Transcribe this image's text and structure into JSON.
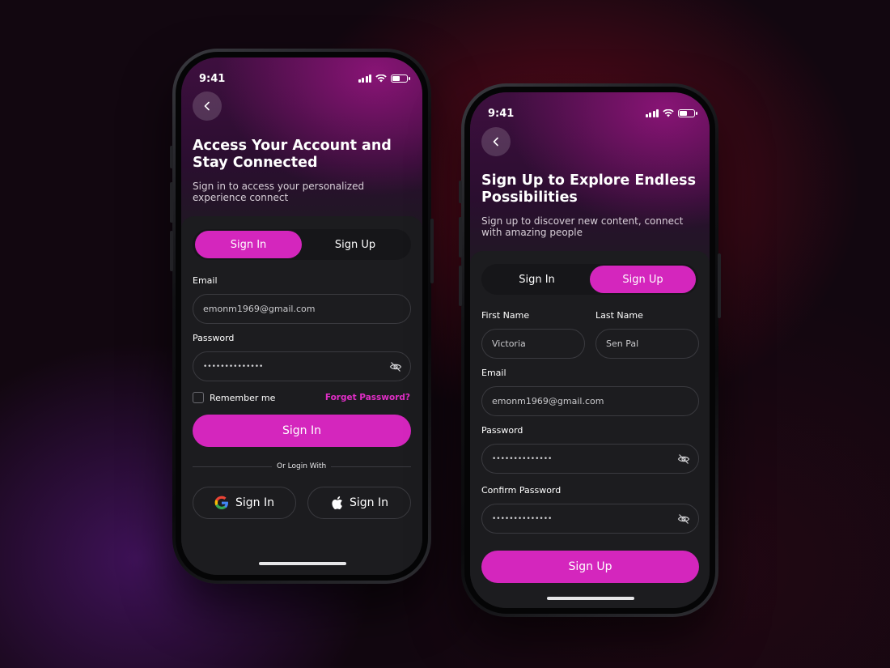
{
  "status_bar": {
    "time": "9:41"
  },
  "sign_in_screen": {
    "title_line1": "Access Your Account and",
    "title_line2": "Stay Connected",
    "subtitle_line1": "Sign in to access your personalized",
    "subtitle_line2": "experience connect",
    "tabs": {
      "sign_in": "Sign In",
      "sign_up": "Sign Up",
      "active": "Sign In"
    },
    "email_label": "Email",
    "email_value": "emonm1969@gmail.com",
    "password_label": "Password",
    "password_value": "••••••••••••••",
    "remember_me": "Remember me",
    "forget_password": "Forget Password?",
    "submit": "Sign In",
    "or_login_with": "Or Login With",
    "google_btn": "Sign In",
    "apple_btn": "Sign In"
  },
  "sign_up_screen": {
    "title_line1": "Sign Up to Explore Endless",
    "title_line2": "Possibilities",
    "subtitle_line1": "Sign up to discover new content, connect",
    "subtitle_line2": "with amazing people",
    "tabs": {
      "sign_in": "Sign In",
      "sign_up": "Sign Up",
      "active": "Sign Up"
    },
    "first_name_label": "First Name",
    "first_name_value": "Victoria",
    "last_name_label": "Last Name",
    "last_name_value": "Sen Pal",
    "email_label": "Email",
    "email_value": "emonm1969@gmail.com",
    "password_label": "Password",
    "password_value": "••••••••••••••",
    "confirm_password_label": "Confirm Password",
    "confirm_password_value": "••••••••••••••",
    "submit": "Sign Up"
  },
  "colors": {
    "accent": "#d426bd",
    "forgot_link": "#e02ec6",
    "card_bg": "#1c1c1f"
  },
  "icons": [
    "back-chevron-icon",
    "eye-off-icon",
    "google-icon",
    "apple-icon",
    "signal-icon",
    "wifi-icon",
    "battery-icon"
  ]
}
